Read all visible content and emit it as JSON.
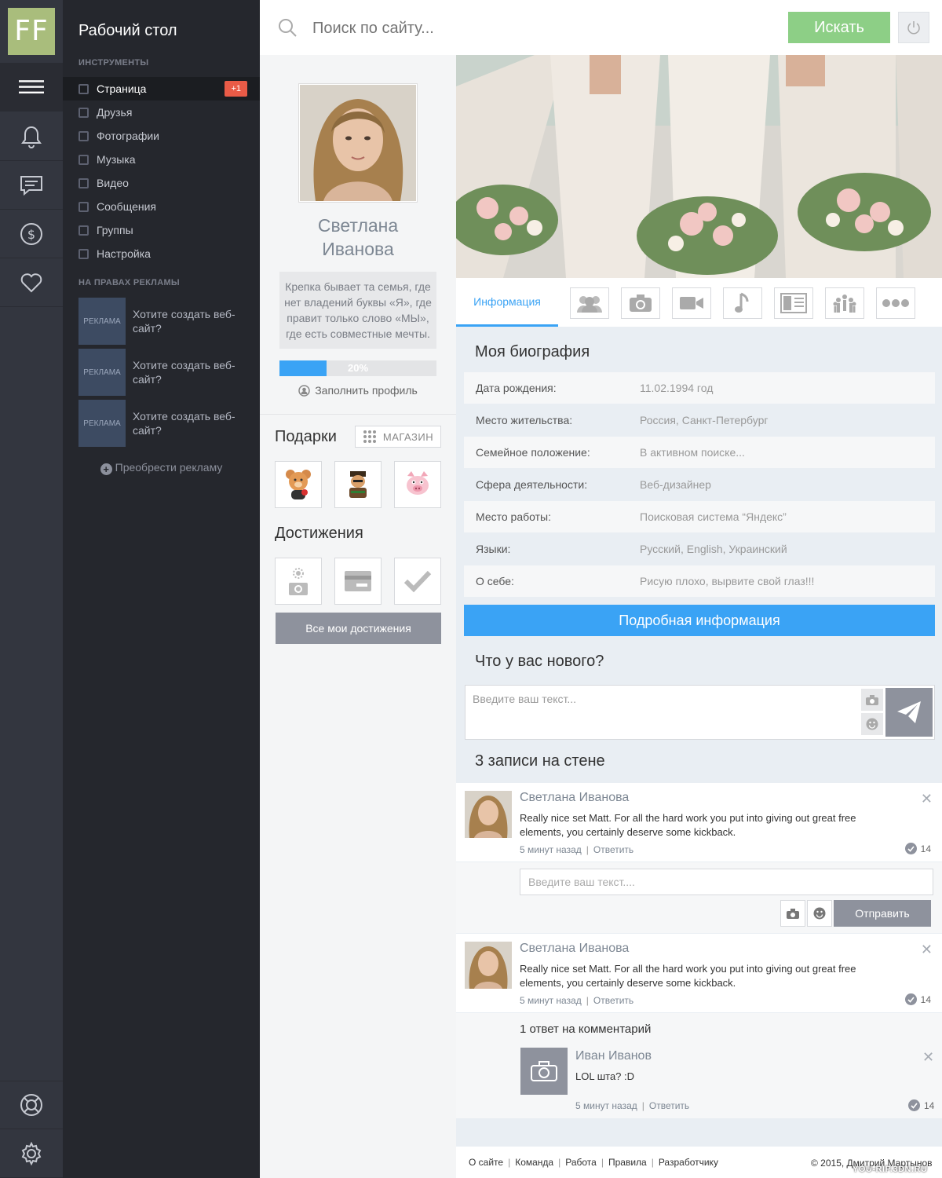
{
  "logo": "FF",
  "sidebar": {
    "title": "Рабочий стол",
    "tools_label": "ИНСТРУМЕНТЫ",
    "items": [
      {
        "label": "Страница",
        "badge": "+1"
      },
      {
        "label": "Друзья"
      },
      {
        "label": "Фотографии"
      },
      {
        "label": "Музыка"
      },
      {
        "label": "Видео"
      },
      {
        "label": "Сообщения"
      },
      {
        "label": "Группы"
      },
      {
        "label": "Настройка"
      }
    ],
    "ads_label": "НА ПРАВАХ РЕКЛАМЫ",
    "ads": [
      {
        "tag": "РЕКЛАМА",
        "text": "Хотите создать веб-сайт?"
      },
      {
        "tag": "РЕКЛАМА",
        "text": "Хотите создать веб-сайт?"
      },
      {
        "tag": "РЕКЛАМА",
        "text": "Хотите создать веб-сайт?"
      }
    ],
    "buy_ad": "Преобрести рекламу"
  },
  "search": {
    "placeholder": "Поиск по сайту...",
    "button": "Искать"
  },
  "profile": {
    "name_line1": "Светлана",
    "name_line2": "Иванова",
    "quote": "Крепка бывает та семья, где нет владений буквы «Я», где правит только слово «МЫ», где есть совместные мечты.",
    "progress": 0.3,
    "progress_label": "20%",
    "fill_profile": "Заполнить профиль",
    "gifts_title": "Подарки",
    "shop_label": "МАГАЗИН",
    "achievements_title": "Достижения",
    "all_achievements": "Все мои достижения"
  },
  "tabs": {
    "info": "Информация"
  },
  "bio": {
    "title": "Моя биография",
    "rows": [
      {
        "label": "Дата рождения:",
        "value": "11.02.1994 год"
      },
      {
        "label": "Место жительства:",
        "value": "Россия, Санкт-Петербург"
      },
      {
        "label": "Семейное положение:",
        "value": "В активном поиске..."
      },
      {
        "label": "Сфера деятельности:",
        "value": "Веб-дизайнер"
      },
      {
        "label": "Место работы:",
        "value": "Поисковая система “Яндекс”"
      },
      {
        "label": "Языки:",
        "value": "Русский, English, Украинский"
      },
      {
        "label": "О себе:",
        "value": "Рисую плохо, вырвите свой глаз!!!"
      }
    ],
    "more": "Подробная информация"
  },
  "new_post": {
    "title": "Что у вас нового?",
    "placeholder": "Введите ваш текст..."
  },
  "wall": {
    "title": "3 записи на стене",
    "posts": [
      {
        "author": "Светлана Иванова",
        "text": "Really nice set Matt. For all the hard work you put into giving out great free elements, you certainly deserve some kickback.",
        "time": "5 минут назад",
        "reply": "Ответить",
        "likes": "14"
      },
      {
        "author": "Светлана Иванова",
        "text": "Really nice set Matt. For all the hard work you put into giving out great free elements, you certainly deserve some kickback.",
        "time": "5 минут назад",
        "reply": "Ответить",
        "likes": "14"
      }
    ],
    "reply_placeholder": "Введите ваш текст....",
    "send": "Отправить",
    "replies_title": "1 ответ на комментарий",
    "reply_item": {
      "author": "Иван Иванов",
      "text": "LOL шта? :D",
      "time": "5 минут назад",
      "reply": "Ответить",
      "likes": "14"
    }
  },
  "footer": {
    "links": [
      "О сайте",
      "Команда",
      "Работа",
      "Правила",
      "Разработчику"
    ],
    "copyright": "© 2015, Дмитрий Мартынов"
  },
  "watermark": "YOU-RIP.3DN.RU",
  "colors": {
    "accent": "#3aa3f5",
    "search_button": "#8dcf86",
    "badge": "#e95b47",
    "rail": "#33363f",
    "sidebar": "#25272d"
  }
}
